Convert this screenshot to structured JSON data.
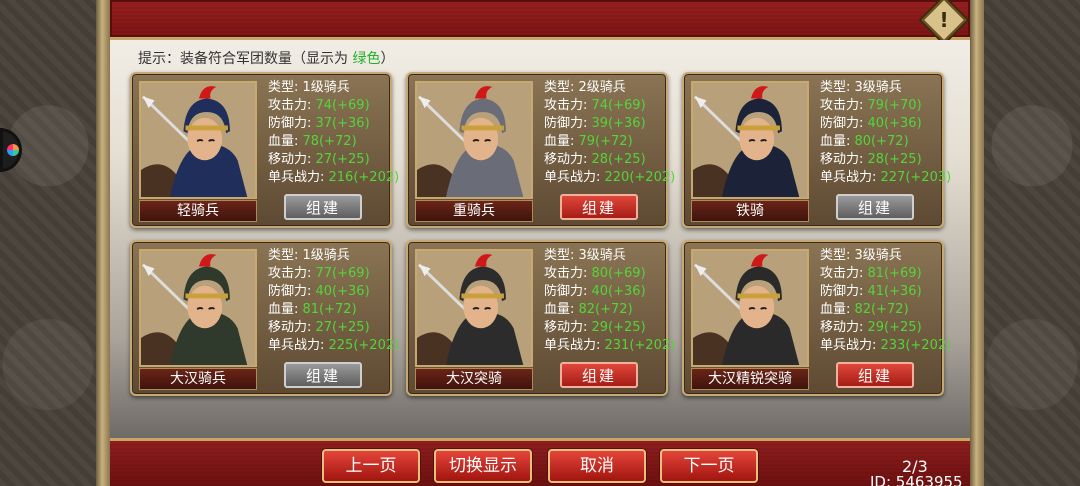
{
  "hint": {
    "prefix": "提示：装备符合军团数量（显示为 ",
    "green": "绿色",
    "suffix": "）"
  },
  "cards": [
    {
      "name": "轻骑兵",
      "type": "类型: 1级骑兵",
      "atk": "74(+69)",
      "def": "37(+36)",
      "hp": "78(+72)",
      "move": "27(+25)",
      "power": "216(+202)",
      "button": "组建",
      "button_style": "gray",
      "helmet_color": "#1f2e5a"
    },
    {
      "name": "重骑兵",
      "type": "类型: 2级骑兵",
      "atk": "74(+69)",
      "def": "39(+36)",
      "hp": "79(+72)",
      "move": "28(+25)",
      "power": "220(+202)",
      "button": "组建",
      "button_style": "red",
      "helmet_color": "#6a6d78"
    },
    {
      "name": "铁骑",
      "type": "类型: 3级骑兵",
      "atk": "79(+70)",
      "def": "40(+36)",
      "hp": "80(+72)",
      "move": "28(+25)",
      "power": "227(+203)",
      "button": "组建",
      "button_style": "gray",
      "helmet_color": "#1c2238"
    },
    {
      "name": "大汉骑兵",
      "type": "类型: 1级骑兵",
      "atk": "77(+69)",
      "def": "40(+36)",
      "hp": "81(+72)",
      "move": "27(+25)",
      "power": "225(+202)",
      "button": "组建",
      "button_style": "gray",
      "helmet_color": "#2f3a2c"
    },
    {
      "name": "大汉突骑",
      "type": "类型: 3级骑兵",
      "atk": "80(+69)",
      "def": "40(+36)",
      "hp": "82(+72)",
      "move": "29(+25)",
      "power": "231(+202)",
      "button": "组建",
      "button_style": "red",
      "helmet_color": "#2c2c2c"
    },
    {
      "name": "大汉精锐突骑",
      "type": "类型: 3级骑兵",
      "atk": "81(+69)",
      "def": "41(+36)",
      "hp": "82(+72)",
      "move": "29(+25)",
      "power": "233(+202)",
      "button": "组建",
      "button_style": "red",
      "helmet_color": "#2a2a2a"
    }
  ],
  "labels": {
    "atk": "攻击力: ",
    "def": "防御力: ",
    "hp": "血量: ",
    "move": "移动力: ",
    "power": "单兵战力: "
  },
  "nav": {
    "prev": "上一页",
    "toggle": "切换显示",
    "cancel": "取消",
    "next": "下一页"
  },
  "page": "2/3",
  "player_id": "ID: 5463955",
  "colors": {
    "accent_green": "#55d43a",
    "frame_red": "#8f1e1e",
    "gold": "#c9a564"
  },
  "icons": {
    "alert": "warning-icon"
  }
}
